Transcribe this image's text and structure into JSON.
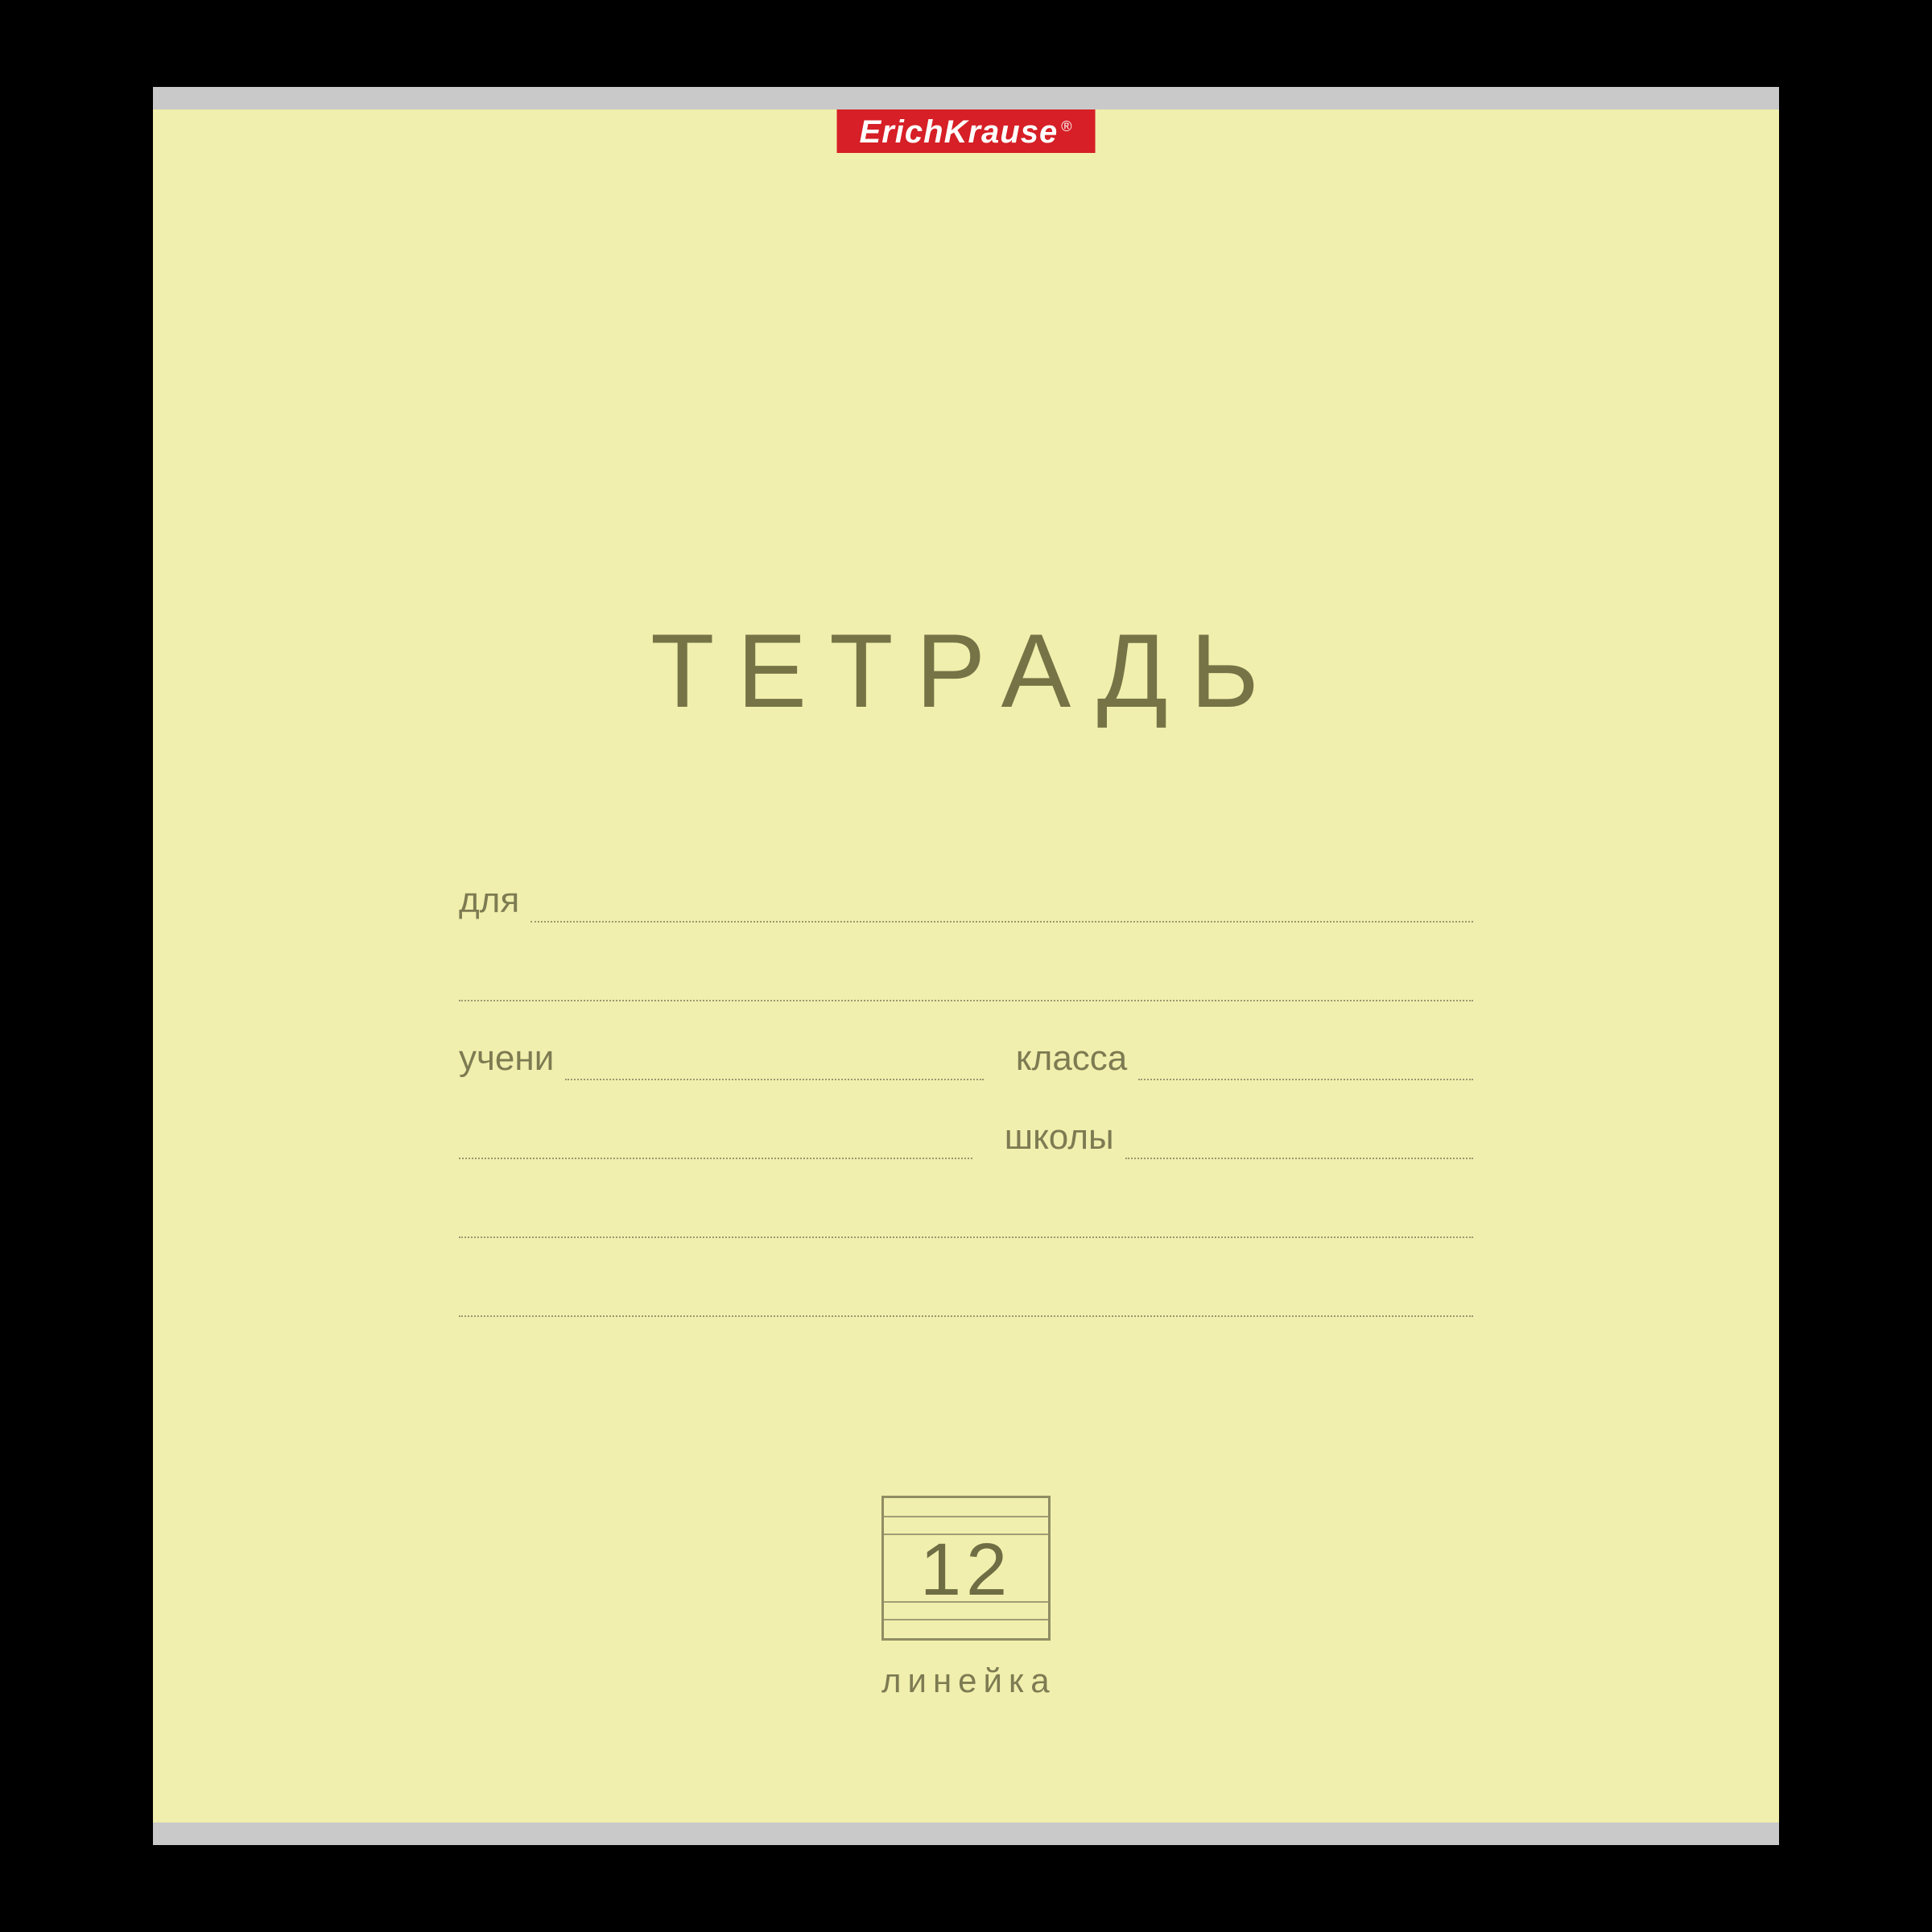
{
  "brand": {
    "name": "ErichKrause",
    "reg": "®"
  },
  "cover": {
    "title": "ТЕТРАДЬ",
    "labels": {
      "for": "для",
      "student": "учени",
      "class": "класса",
      "school": "школы"
    },
    "pages": "12",
    "ruling": "линейка"
  },
  "colors": {
    "cover_bg": "#f1efad",
    "brand_bg": "#d61f26",
    "text": "#7d7b52",
    "staple": "#c9c9c9"
  }
}
